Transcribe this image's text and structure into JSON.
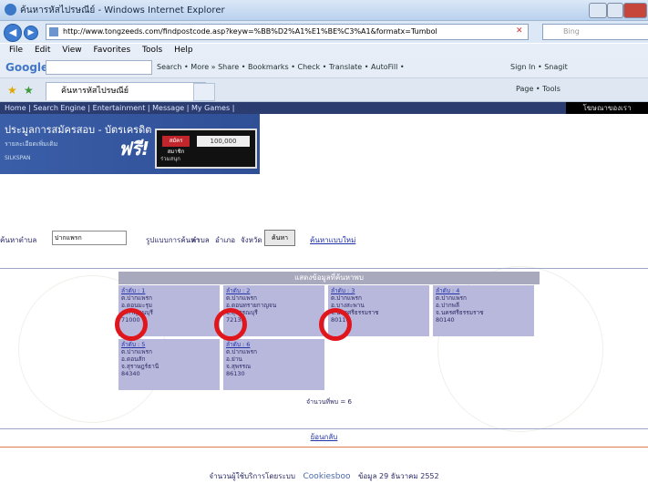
{
  "browser": {
    "window_title": "ค้นหารหัสไปรษณีย์ - Windows Internet Explorer",
    "address": "http://www.tongzeeds.com/findpostcode.asp?keyw=%BB%D2%A1%E1%BE%C3%A1&formatx=Tumbol",
    "search_placeholder": "Bing",
    "menu": [
      "File",
      "Edit",
      "View",
      "Favorites",
      "Tools",
      "Help"
    ],
    "google_label": "Google",
    "google_tools": "Search • More » Share • Bookmarks • Check • Translate • AutoFill •",
    "google_right": "Sign In • Snagit",
    "tab_title": "ค้นหารหัสไปรษณีย์",
    "fav_right": "Page • Tools"
  },
  "site": {
    "top_nav": "Home | Search Engine | Entertainment | Message | My Games |",
    "top_right": "โฆษณาของเรา",
    "banner_heading": "ประมูลการสมัครสอบ - บัตรเครดิต",
    "banner_sub": "รายละเอียดเพิ่มเติม",
    "banner_free": "ฟรี!",
    "banner_small": "SILKSPAN",
    "banner_card_red": "สมัครสมาชิก",
    "banner_card_amount": "100,000",
    "banner_card_caption": "ร่วมสนุก",
    "search_label": "ค้นหาตำบล",
    "search_value": "ปากแพรก",
    "format_label": "รูปแบบการค้นหา",
    "opt1": "ตำบล",
    "opt2": "อำเภอ",
    "opt3_label": "จังหวัด",
    "search_button": "ค้นหา",
    "reset_link": "ค้นหาแบบใหม่"
  },
  "results": {
    "header": "แสดงข้อมูลที่ค้นหาพบ",
    "items": [
      {
        "no": "ลำดับ : 1",
        "l1": "ต.ปากแพรก",
        "l2": "อ.ดอนมะรุม",
        "l3": "จ.กาญจนบุรี",
        "zip": "71000"
      },
      {
        "no": "ลำดับ : 2",
        "l1": "ต.ปากแพรก",
        "l2": "อ.ดอนทรายกาญจน",
        "l3": "จ.สุพรรณบุรี",
        "zip": "72130"
      },
      {
        "no": "ลำดับ : 3",
        "l1": "ต.ปากแพรก",
        "l2": "อ.บางสะพาน",
        "l3": "จ.นครศรีธรรมราช",
        "zip": "80110"
      },
      {
        "no": "ลำดับ : 4",
        "l1": "ต.ปากแพรก",
        "l2": "อ.ปากพลี",
        "l3": "จ.นครศรีธรรมราช",
        "zip": "80140"
      },
      {
        "no": "ลำดับ : 5",
        "l1": "ต.ปากแพรก",
        "l2": "อ.ดอนสัก",
        "l3": "จ.สุราษฎร์ธานี",
        "zip": "84340"
      },
      {
        "no": "ลำดับ : 6",
        "l1": "ต.ปากแพรก",
        "l2": "อ.ย่าน",
        "l3": "จ.สุพรรณ",
        "zip": "86130"
      }
    ],
    "total": "จำนวนที่พบ = 6",
    "back_link": "ย้อนกลับ"
  },
  "footer": {
    "powered_prefix": "จำนวนผู้ใช้บริการโดยระบบ",
    "powered_name": "Cookiesboo",
    "date_text": "ข้อมูล 29 ธันวาคม 2552"
  },
  "highlights": [
    "result-1-zip",
    "result-2-zip",
    "result-3-zip"
  ],
  "colors": {
    "highlight": "#e0161c",
    "result_cell": "#b8b8dc",
    "header_bar": "#a9a9bd",
    "site_nav": "#2a3c70"
  }
}
